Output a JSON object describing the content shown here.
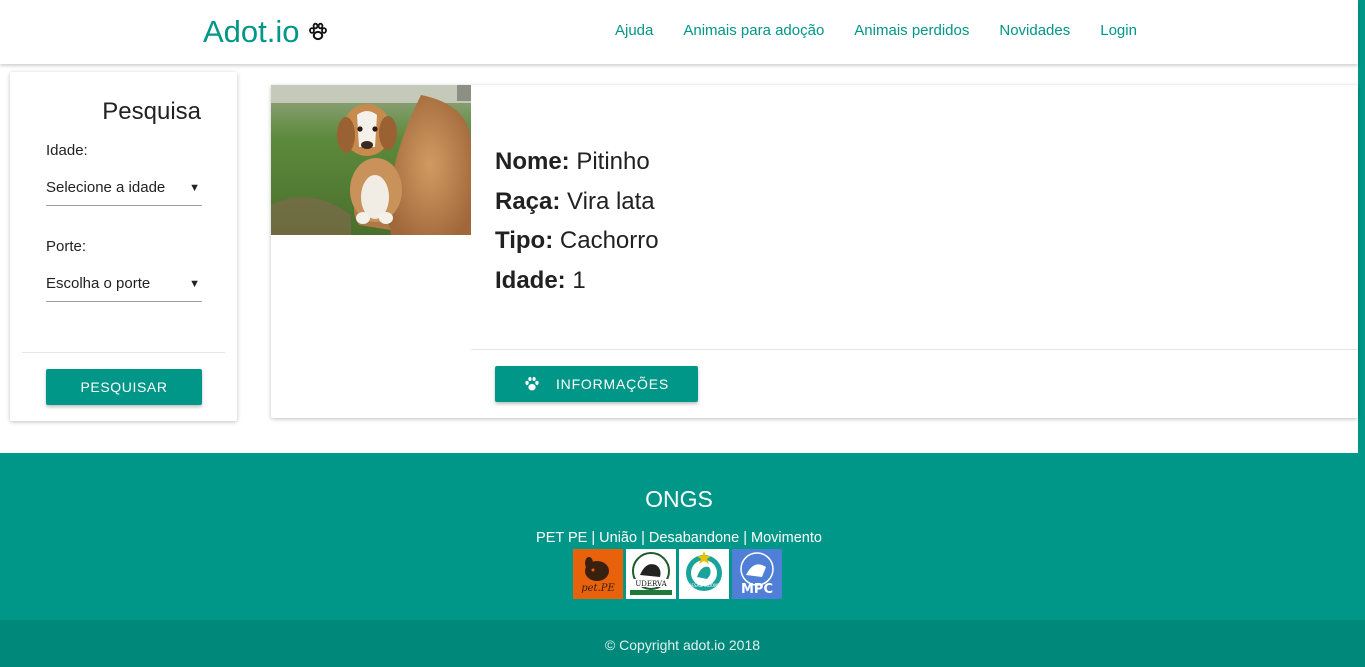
{
  "brand": {
    "name": "Adot.io",
    "icon": "paw-icon"
  },
  "nav": {
    "links": [
      "Ajuda",
      "Animais para adoção",
      "Animais perdidos",
      "Novidades",
      "Login"
    ]
  },
  "search": {
    "title": "Pesquisa",
    "age_label": "Idade:",
    "age_value": "Selecione a idade",
    "size_label": "Porte:",
    "size_value": "Escolha o porte",
    "button_label": "PESQUISAR"
  },
  "animal": {
    "photo_alt": "Pitinho",
    "fields": [
      {
        "key": "Nome:",
        "value": "Pitinho"
      },
      {
        "key": "Raça:",
        "value": "Vira lata"
      },
      {
        "key": "Tipo:",
        "value": "Cachorro"
      },
      {
        "key": "Idade:",
        "value": "1"
      }
    ],
    "button_label": "INFORMAÇÕES",
    "button_icon": "paw-icon"
  },
  "footer": {
    "title": "ONGS",
    "ong_links": [
      "PET PE",
      "União",
      "Desabandone",
      "Movimento"
    ],
    "separator": " | ",
    "logos": [
      {
        "name": "petpe-logo",
        "label": "pet.PE",
        "bg": "#e8620c"
      },
      {
        "name": "uderva-logo",
        "label": "UDERVA",
        "bg": "#ffffff"
      },
      {
        "name": "desabandone-logo",
        "label": "DESABANDONE",
        "bg": "#ffffff"
      },
      {
        "name": "mpc-logo",
        "label": "MPC",
        "bg": "#4f7fd6"
      }
    ],
    "copyright": "© Copyright adot.io 2018"
  },
  "colors": {
    "primary": "#009688",
    "primary_dark": "#00897b"
  }
}
